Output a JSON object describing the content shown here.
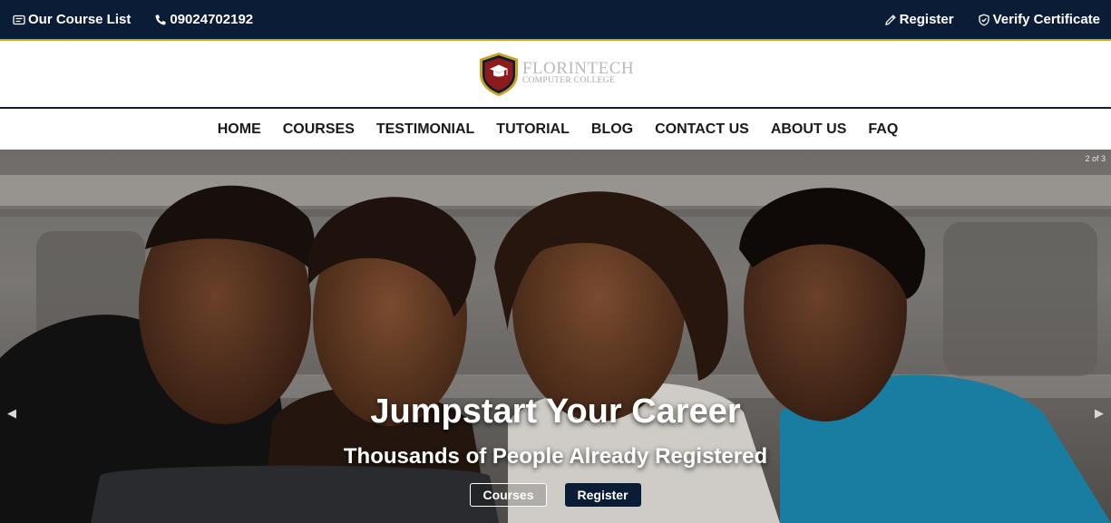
{
  "topbar": {
    "course_list": "Our Course List",
    "phone": "09024702192",
    "register": "Register",
    "verify": "Verify Certificate",
    "icons": [
      "list-card-icon",
      "phone-icon",
      "pencil-icon",
      "shield-check-icon"
    ]
  },
  "logo": {
    "name": "FLORINTECH",
    "sub": "COMPUTER COLLEGE",
    "colors": {
      "shield": "#8c1c1c",
      "border": "#c9a227"
    }
  },
  "nav": {
    "items": [
      "HOME",
      "COURSES",
      "TESTIMONIAL",
      "TUTORIAL",
      "BLOG",
      "CONTACT US",
      "ABOUT US",
      "FAQ"
    ]
  },
  "hero": {
    "counter": "2 of 3",
    "headline": "Jumpstart Your Career",
    "subheadline": "Thousands of People Already Registered",
    "buttons": {
      "courses": "Courses",
      "register": "Register"
    },
    "prev_icon": "chevron-left-icon",
    "next_icon": "chevron-right-icon"
  },
  "colors": {
    "navy": "#0b1d36",
    "gold": "#c9a227",
    "white": "#ffffff"
  }
}
